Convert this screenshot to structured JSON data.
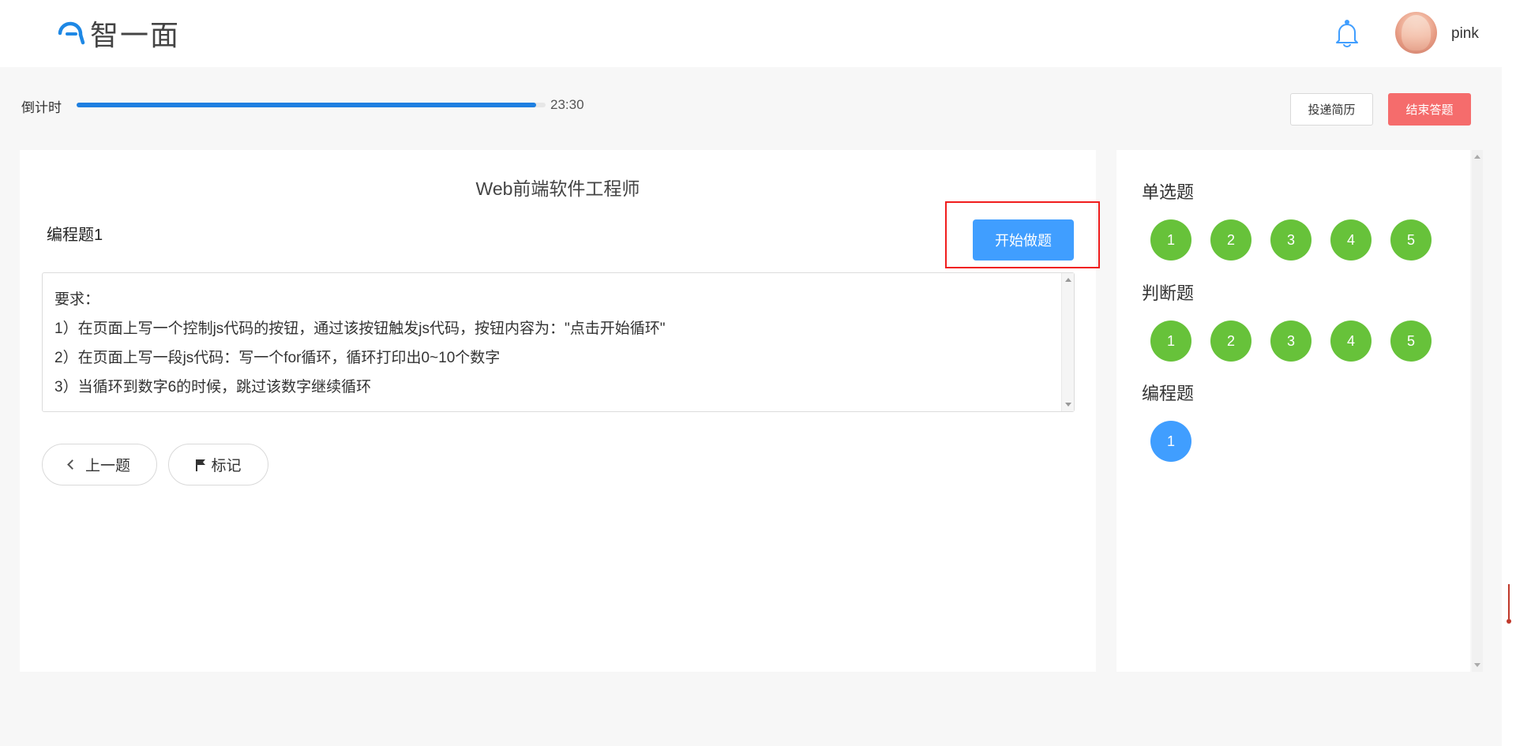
{
  "header": {
    "logo_text": "智一面",
    "username": "pink",
    "colors": {
      "logo_blue": "#1e88e5"
    }
  },
  "countdown": {
    "label": "倒计时",
    "time": "23:30",
    "progress_fraction": 0.98
  },
  "actions": {
    "resume_label": "投递简历",
    "end_label": "结束答题"
  },
  "question": {
    "exam_title": "Web前端软件工程师",
    "title": "编程题1",
    "start_label": "开始做题",
    "requirements": [
      "要求：",
      "1）在页面上写一个控制js代码的按钮，通过该按钮触发js代码，按钮内容为：\"点击开始循环\"",
      "2）在页面上写一段js代码：写一个for循环，循环打印出0~10个数字",
      "3）当循环到数字6的时候，跳过该数字继续循环"
    ],
    "prev_label": "上一题",
    "mark_label": "标记"
  },
  "sidebar": {
    "sections": [
      {
        "title": "单选题",
        "items": [
          "1",
          "2",
          "3",
          "4",
          "5"
        ],
        "status": "answered"
      },
      {
        "title": "判断题",
        "items": [
          "1",
          "2",
          "3",
          "4",
          "5"
        ],
        "status": "answered"
      },
      {
        "title": "编程题",
        "items": [
          "1"
        ],
        "status": "current"
      }
    ],
    "colors": {
      "answered": "#67c23a",
      "current": "#409eff"
    }
  }
}
